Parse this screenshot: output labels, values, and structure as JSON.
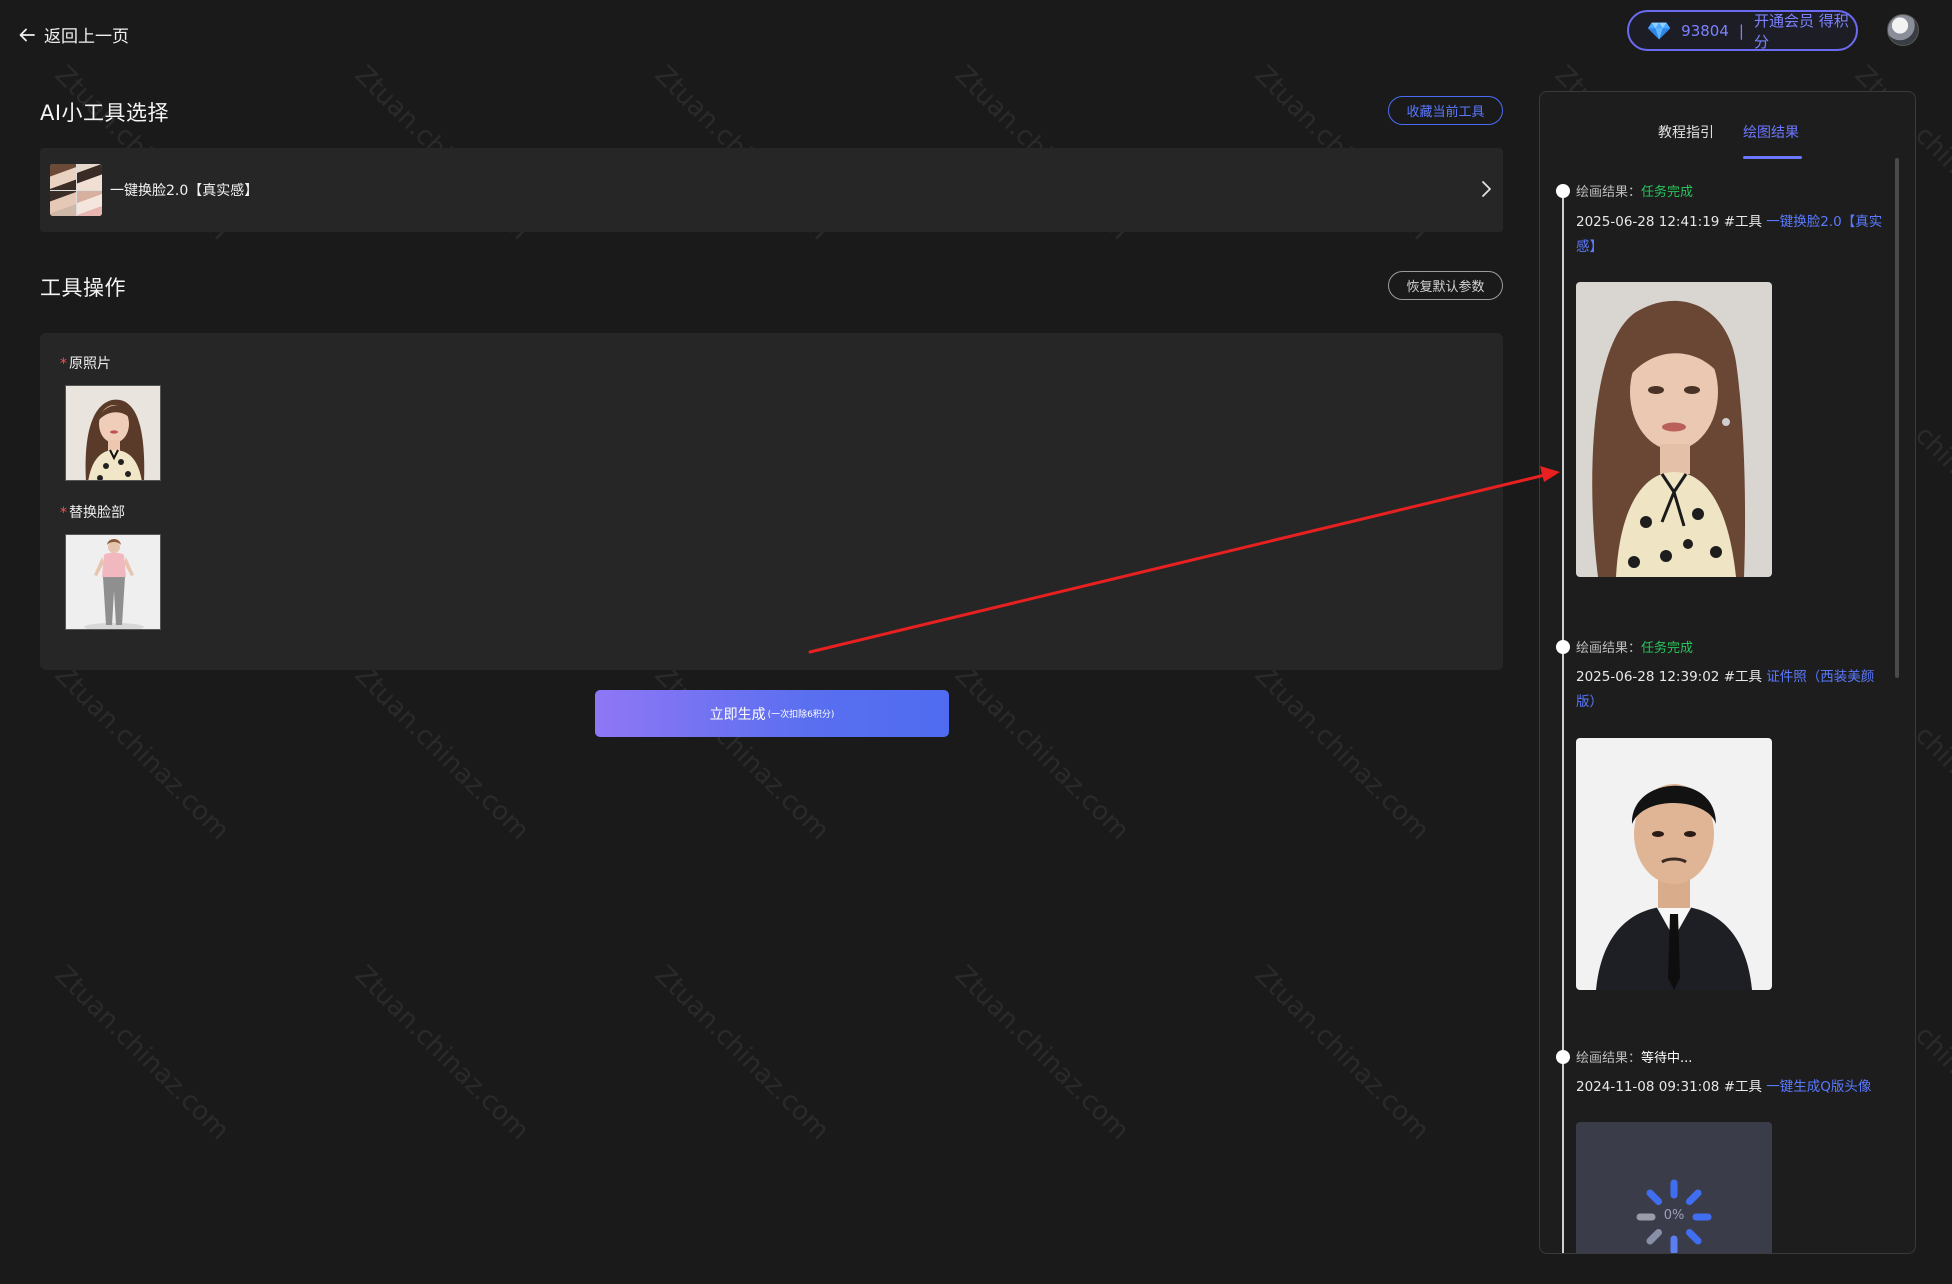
{
  "header": {
    "back_label": "返回上一页",
    "points": "93804",
    "separator": "|",
    "vip_label": "开通会员 得积分"
  },
  "tool_select": {
    "title": "AI小工具选择",
    "favorite_button": "收藏当前工具",
    "selected_tool": "一键换脸2.0【真实感】"
  },
  "tool_ops": {
    "title": "工具操作",
    "reset_button": "恢复默认参数",
    "fields": [
      {
        "required_mark": "*",
        "label": "原照片"
      },
      {
        "required_mark": "*",
        "label": "替换脸部"
      }
    ],
    "generate_label": "立即生成",
    "generate_cost": "(一次扣除6积分)"
  },
  "results_panel": {
    "tabs": [
      {
        "label": "教程指引"
      },
      {
        "label": "绘图结果"
      }
    ],
    "active_tab": "绘图结果",
    "entries": [
      {
        "status_label": "绘画结果：",
        "status": "任务完成",
        "datetime": "2025-06-28 12:41:19",
        "tool_prefix": "#工具",
        "tool_name": "一键换脸2.0【真实感】"
      },
      {
        "status_label": "绘画结果：",
        "status": "任务完成",
        "datetime": "2025-06-28 12:39:02",
        "tool_prefix": "#工具",
        "tool_name": "证件照（西装美颜版）"
      },
      {
        "status_label": "绘画结果：",
        "status": "等待中...",
        "datetime": "2024-11-08 09:31:08",
        "tool_prefix": "#工具",
        "tool_name": "一键生成Q版头像",
        "progress": "0%"
      }
    ]
  },
  "watermark": "Ztuan.chinaz.com",
  "colors": {
    "accent": "#5a79ff",
    "success": "#27c45a",
    "background": "#1a1a1b",
    "panel": "#262627",
    "arrow": "#e82020"
  }
}
